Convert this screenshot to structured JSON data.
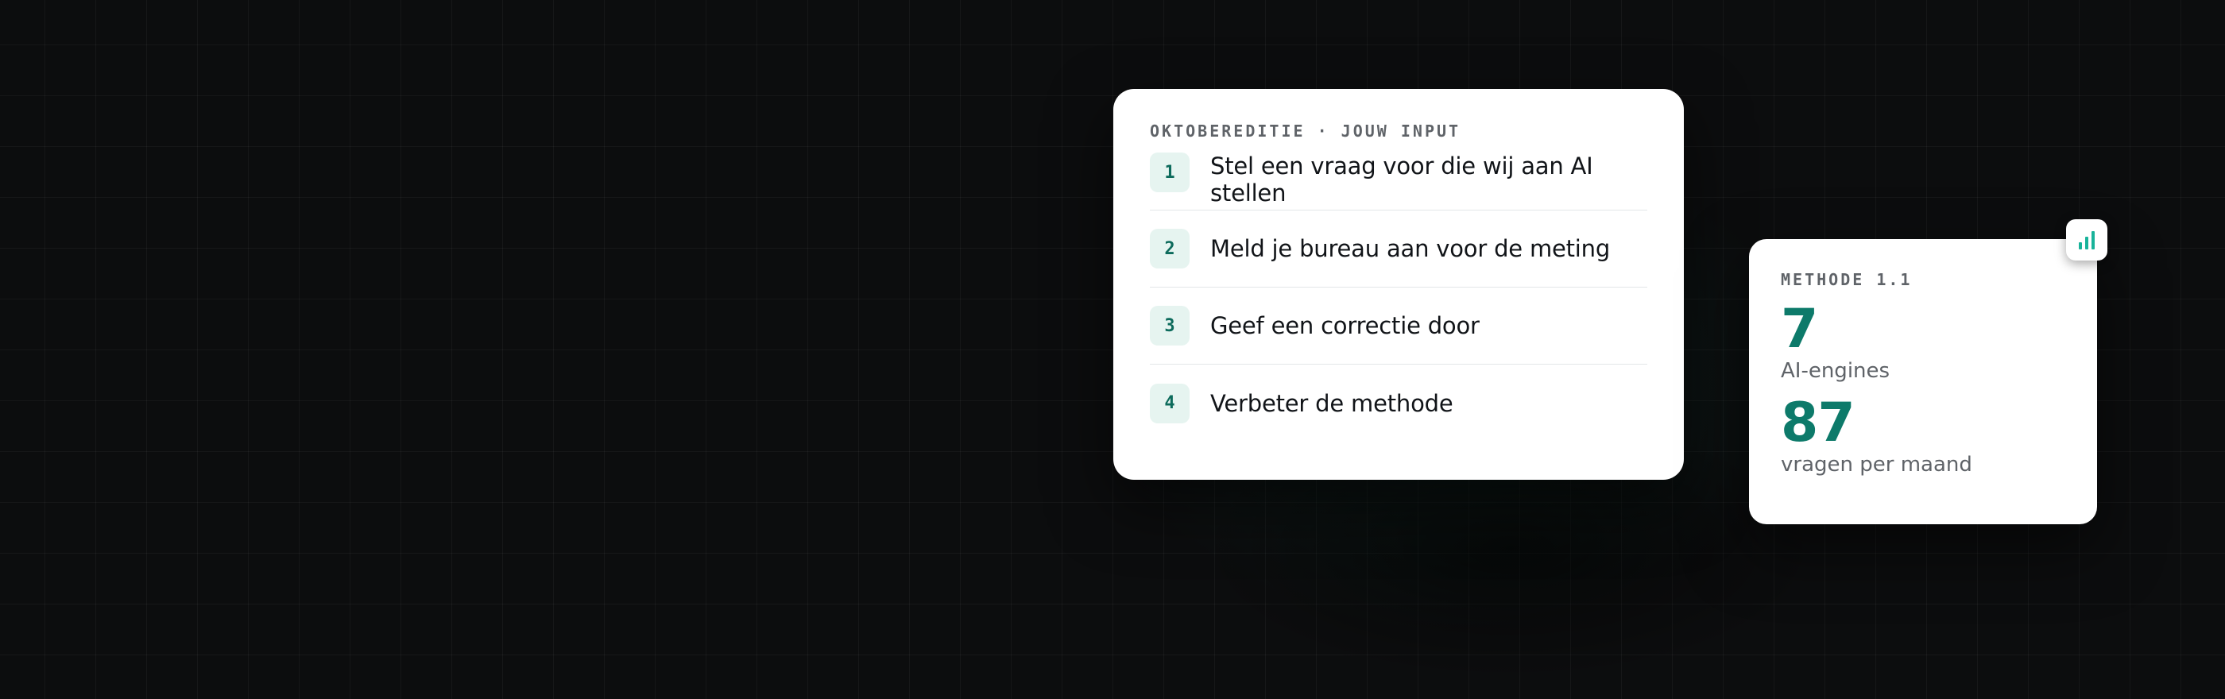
{
  "input_card": {
    "eyebrow": "OKTOBEREDITIE · JOUW INPUT",
    "steps": [
      {
        "number": "1",
        "label": "Stel een vraag voor die wij aan AI stellen"
      },
      {
        "number": "2",
        "label": "Meld je bureau aan voor de meting"
      },
      {
        "number": "3",
        "label": "Geef een correctie door"
      },
      {
        "number": "4",
        "label": "Verbeter de methode"
      }
    ]
  },
  "method_card": {
    "eyebrow": "METHODE 1.1",
    "badge_icon": "bar-chart-icon",
    "stats": [
      {
        "value": "7",
        "label": "AI-engines"
      },
      {
        "value": "87",
        "label": "vragen per maand"
      }
    ]
  },
  "colors": {
    "background": "#0c0d0e",
    "accent": "#0d7a6a",
    "badge_bg": "#e6f4f0",
    "icon_teal": "#18b39a"
  }
}
